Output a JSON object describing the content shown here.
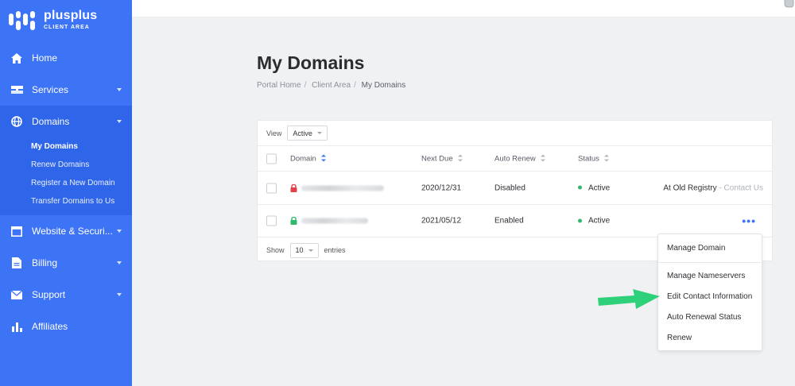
{
  "brand": {
    "name": "plusplus",
    "subtitle": "CLIENT AREA"
  },
  "sidebar": {
    "items": [
      {
        "label": "Home",
        "icon": "home-icon"
      },
      {
        "label": "Services",
        "icon": "server-icon"
      },
      {
        "label": "Domains",
        "icon": "globe-icon"
      },
      {
        "label": "Website & Securi...",
        "icon": "window-icon"
      },
      {
        "label": "Billing",
        "icon": "file-icon"
      },
      {
        "label": "Support",
        "icon": "envelope-icon"
      },
      {
        "label": "Affiliates",
        "icon": "bar-chart-icon"
      }
    ],
    "domains_sub": [
      "My Domains",
      "Renew Domains",
      "Register a New Domain",
      "Transfer Domains to Us"
    ]
  },
  "page": {
    "title": "My Domains",
    "breadcrumb": [
      "Portal Home",
      "Client Area",
      "My Domains"
    ]
  },
  "table": {
    "view_label": "View",
    "view_value": "Active",
    "columns": [
      "Domain",
      "Next Due",
      "Auto Renew",
      "Status"
    ],
    "rows": [
      {
        "domain": "",
        "next_due": "2020/12/31",
        "auto_renew": "Disabled",
        "status": "Active",
        "note": "At Old Registry",
        "note_sep": " - ",
        "note_link": "Contact Us",
        "lock_color": "#e0424b"
      },
      {
        "domain": "",
        "next_due": "2021/05/12",
        "auto_renew": "Enabled",
        "status": "Active",
        "more": "•••",
        "lock_color": "#2fb86e"
      }
    ],
    "show_label": "Show",
    "show_value": "10",
    "entries_label": "entries"
  },
  "menu": {
    "items": [
      "Manage Domain",
      "Manage Nameservers",
      "Edit Contact Information",
      "Auto Renewal Status",
      "Renew"
    ]
  },
  "colors": {
    "accent": "#3d73f5",
    "active": "#2fb86e",
    "arrow": "#2fd07a"
  }
}
